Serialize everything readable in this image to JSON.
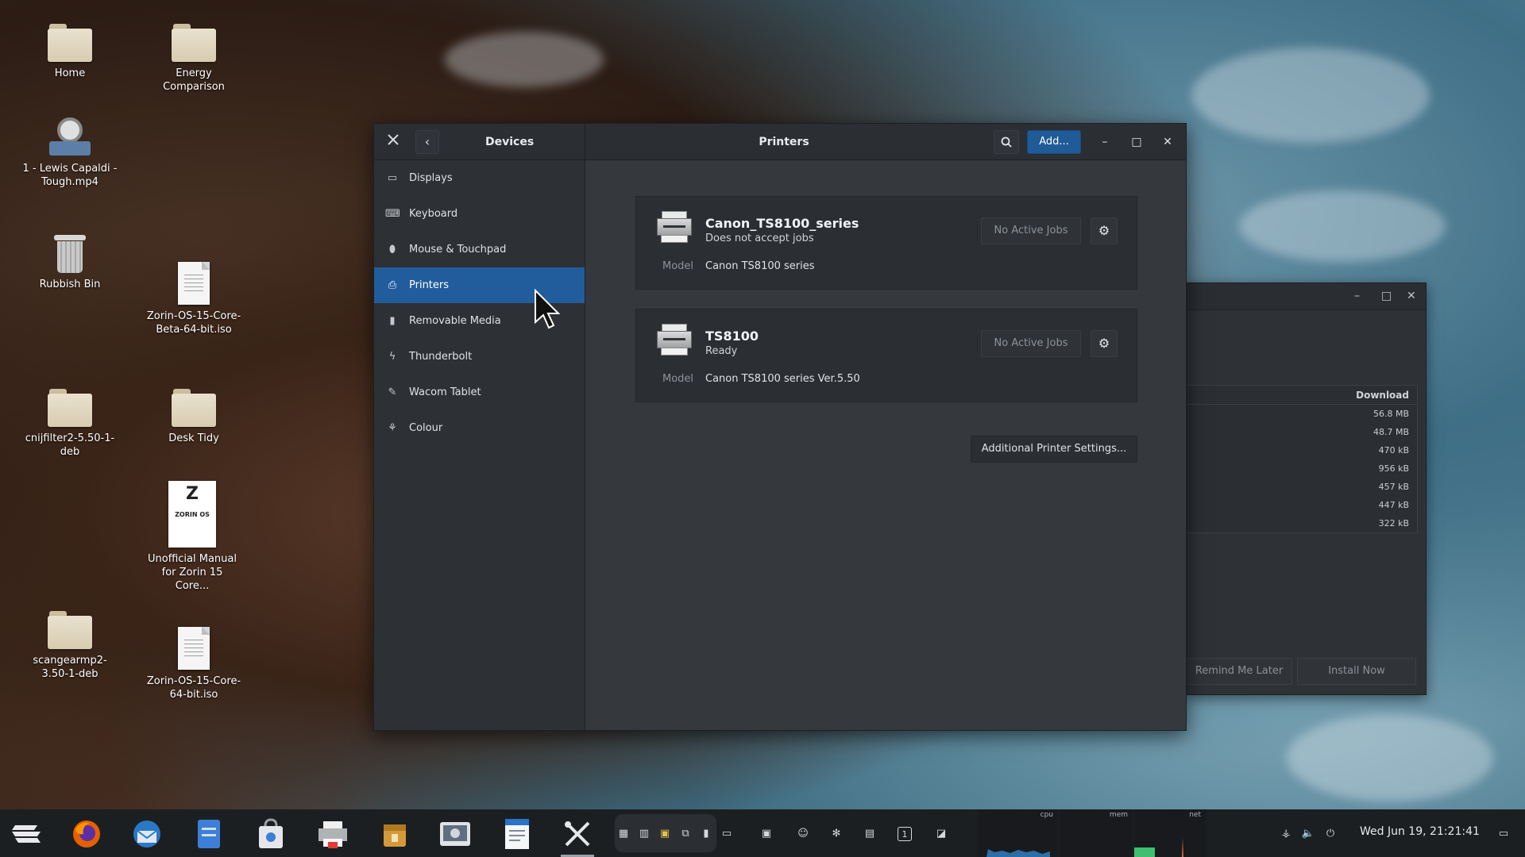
{
  "desktop": {
    "icons": [
      {
        "label": "Home"
      },
      {
        "label": "Energy Comparison"
      },
      {
        "label": "1 - Lewis Capaldi - Tough.mp4"
      },
      {
        "label": "Rubbish Bin"
      },
      {
        "label": "Zorin-OS-15-Core-Beta-64-bit.iso"
      },
      {
        "label": "cnijfilter2-5.50-1-deb"
      },
      {
        "label": "Desk Tidy"
      },
      {
        "label": "Unofficial Manual for Zorin 15 Core..."
      },
      {
        "label": "scangearmp2-3.50-1-deb"
      },
      {
        "label": "Zorin-OS-15-Core-64-bit.iso"
      }
    ],
    "manual_cover": {
      "logo": "Z",
      "text": "ZORIN OS"
    }
  },
  "background_window": {
    "column_header": "Download",
    "sizes": [
      "56.8 MB",
      "48.7 MB",
      "470 kB",
      "956 kB",
      "457 kB",
      "447 kB",
      "322 kB"
    ],
    "remind_label": "Remind Me Later",
    "install_label": "Install Now"
  },
  "window": {
    "left_title": "Devices",
    "center_title": "Printers",
    "add_label": "Add...",
    "icons": {
      "settings": "tools-icon",
      "back": "chevron-left-icon",
      "search": "search-icon"
    }
  },
  "sidebar": {
    "items": [
      {
        "label": "Displays",
        "icon": "display-icon"
      },
      {
        "label": "Keyboard",
        "icon": "keyboard-icon"
      },
      {
        "label": "Mouse & Touchpad",
        "icon": "mouse-icon"
      },
      {
        "label": "Printers",
        "icon": "printer-icon",
        "active": true
      },
      {
        "label": "Removable Media",
        "icon": "usb-icon"
      },
      {
        "label": "Thunderbolt",
        "icon": "thunderbolt-icon"
      },
      {
        "label": "Wacom Tablet",
        "icon": "tablet-icon"
      },
      {
        "label": "Colour",
        "icon": "colour-icon"
      }
    ],
    "active_color": "#215d9c"
  },
  "printers": [
    {
      "name": "Canon_TS8100_series",
      "status": "Does not accept jobs",
      "jobs_label": "No Active Jobs",
      "model_label": "Model",
      "model": "Canon TS8100 series"
    },
    {
      "name": "TS8100",
      "status": "Ready",
      "jobs_label": "No Active Jobs",
      "model_label": "Model",
      "model": "Canon TS8100 series Ver.5.50"
    }
  ],
  "additional_settings_label": "Additional Printer Settings...",
  "taskbar": {
    "apps": [
      "zorin-menu-icon",
      "firefox-icon",
      "thunderbird-icon",
      "files-icon",
      "software-icon",
      "printer-app-icon",
      "archive-icon",
      "screenshot-icon",
      "writer-icon",
      "settings-tools-icon"
    ],
    "monitor_labels": [
      "cpu",
      "mem",
      "net"
    ],
    "workspace": "1",
    "clock": "Wed Jun 19, 21:21:41"
  }
}
